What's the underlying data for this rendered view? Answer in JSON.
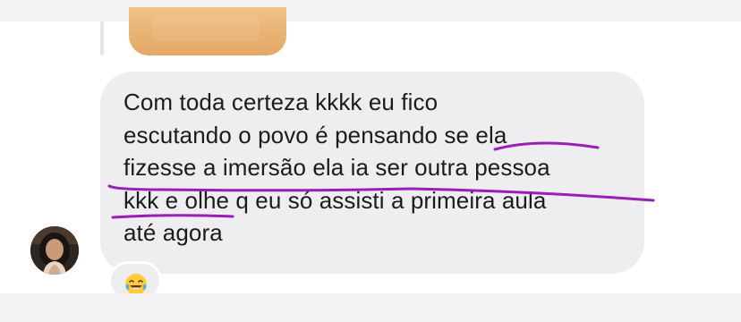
{
  "message": {
    "lines": [
      "Com toda certeza kkkk eu fico",
      "escutando o povo é pensando se ela",
      "fizesse a imersão ela ia ser outra pessoa",
      "kkk e olhe q eu só assisti a primeira aula",
      "até agora"
    ]
  },
  "reaction": {
    "icon": "laughing-tears-emoji-icon"
  },
  "sender": {
    "avatar_icon": "avatar-photo"
  },
  "colors": {
    "bubble": "#eeeef0",
    "text": "#1c1c1e",
    "annotation": "#9b1fb5",
    "strip": "#f2f2f4"
  }
}
